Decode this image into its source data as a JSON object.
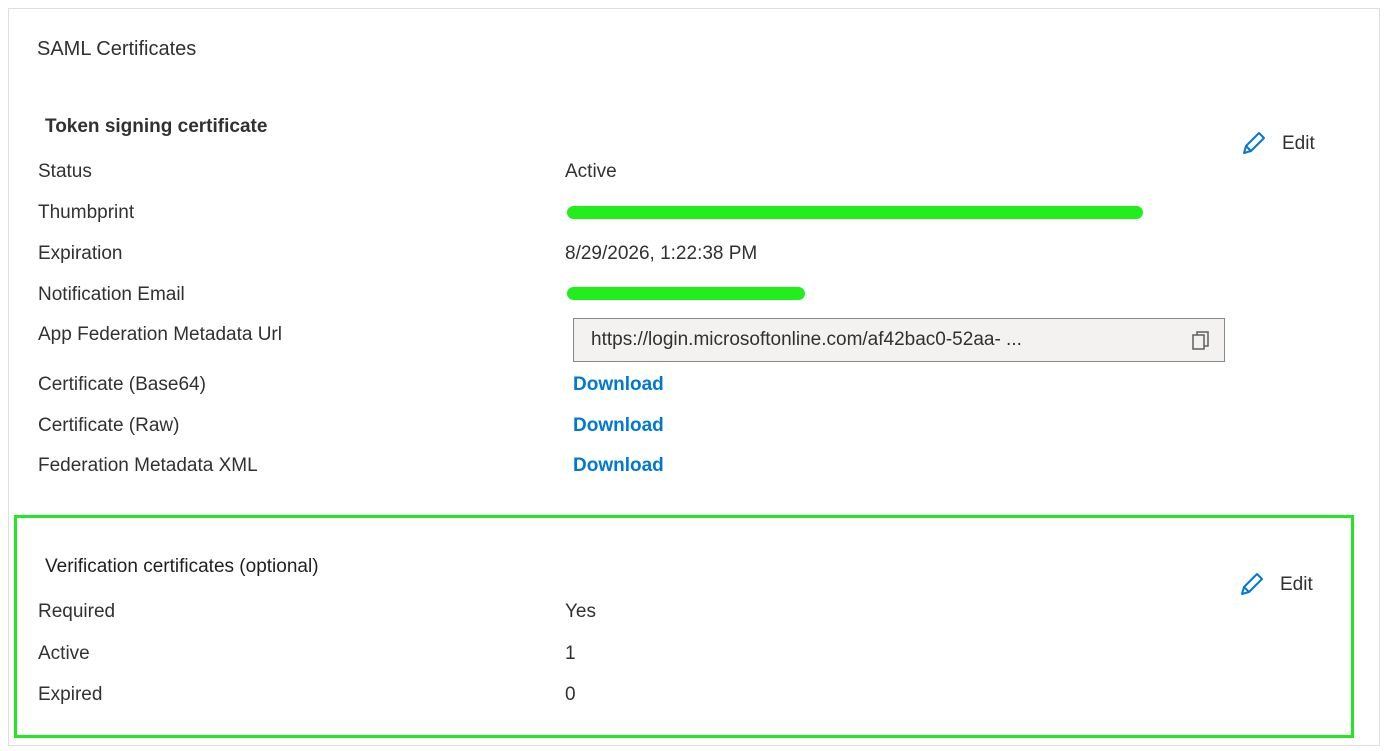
{
  "card": {
    "title": "SAML Certificates"
  },
  "token_signing": {
    "title": "Token signing certificate",
    "edit_label": "Edit",
    "rows": [
      {
        "label": "Status",
        "value": "Active"
      },
      {
        "label": "Thumbprint",
        "value": ""
      },
      {
        "label": "Expiration",
        "value": "8/29/2026, 1:22:38 PM"
      },
      {
        "label": "Notification Email",
        "value": ""
      },
      {
        "label": "App Federation Metadata Url",
        "value": "https://login.microsoftonline.com/af42bac0-52aa- ..."
      },
      {
        "label": "Certificate (Base64)",
        "value": "Download"
      },
      {
        "label": "Certificate (Raw)",
        "value": "Download"
      },
      {
        "label": "Federation Metadata XML",
        "value": "Download"
      }
    ]
  },
  "verification": {
    "title": "Verification certificates (optional)",
    "edit_label": "Edit",
    "rows": [
      {
        "label": "Required",
        "value": "Yes"
      },
      {
        "label": "Active",
        "value": "1"
      },
      {
        "label": "Expired",
        "value": "0"
      }
    ]
  },
  "icons": {
    "edit": "pencil-icon",
    "copy": "copy-icon"
  },
  "colors": {
    "link": "#0078d4",
    "highlight": "#22e822",
    "redaction": "#22ee1e"
  }
}
